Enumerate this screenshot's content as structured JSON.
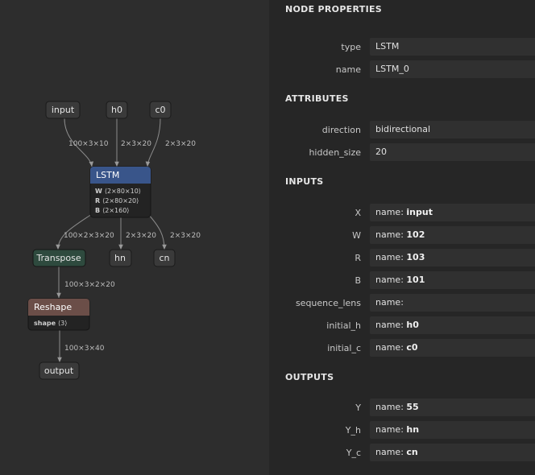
{
  "graph": {
    "nodes": {
      "input": "input",
      "h0": "h0",
      "c0": "c0",
      "lstm": "LSTM",
      "transpose": "Transpose",
      "hn": "hn",
      "cn": "cn",
      "reshape": "Reshape",
      "output": "output"
    },
    "lstm_attrs": [
      {
        "key": "W",
        "value": "⟨2×80×10⟩"
      },
      {
        "key": "R",
        "value": "⟨2×80×20⟩"
      },
      {
        "key": "B",
        "value": "⟨2×160⟩"
      }
    ],
    "reshape_attrs": [
      {
        "key": "shape",
        "value": "⟨3⟩"
      }
    ],
    "edges": {
      "input_lstm": "100×3×10",
      "h0_lstm": "2×3×20",
      "c0_lstm": "2×3×20",
      "lstm_transpose": "100×2×3×20",
      "lstm_hn": "2×3×20",
      "lstm_cn": "2×3×20",
      "transpose_reshape": "100×3×2×20",
      "reshape_output": "100×3×40"
    },
    "colors": {
      "lstm_header": "#39558a",
      "transpose_header": "#2e4a3e",
      "reshape_header": "#6b4e48",
      "io_node": "#3a3a3a"
    }
  },
  "properties": {
    "node_title": "NODE PROPERTIES",
    "node": [
      {
        "label": "type",
        "value": "LSTM"
      },
      {
        "label": "name",
        "value": "LSTM_0"
      }
    ],
    "attributes_title": "ATTRIBUTES",
    "attributes": [
      {
        "label": "direction",
        "value": "bidirectional"
      },
      {
        "label": "hidden_size",
        "value": "20"
      }
    ],
    "inputs_title": "INPUTS",
    "inputs": [
      {
        "label": "X",
        "prefix": "name: ",
        "value": "input"
      },
      {
        "label": "W",
        "prefix": "name: ",
        "value": "102"
      },
      {
        "label": "R",
        "prefix": "name: ",
        "value": "103"
      },
      {
        "label": "B",
        "prefix": "name: ",
        "value": "101"
      },
      {
        "label": "sequence_lens",
        "prefix": "name:",
        "value": ""
      },
      {
        "label": "initial_h",
        "prefix": "name: ",
        "value": "h0"
      },
      {
        "label": "initial_c",
        "prefix": "name: ",
        "value": "c0"
      }
    ],
    "outputs_title": "OUTPUTS",
    "outputs": [
      {
        "label": "Y",
        "prefix": "name: ",
        "value": "55"
      },
      {
        "label": "Y_h",
        "prefix": "name: ",
        "value": "hn"
      },
      {
        "label": "Y_c",
        "prefix": "name: ",
        "value": "cn"
      }
    ]
  }
}
